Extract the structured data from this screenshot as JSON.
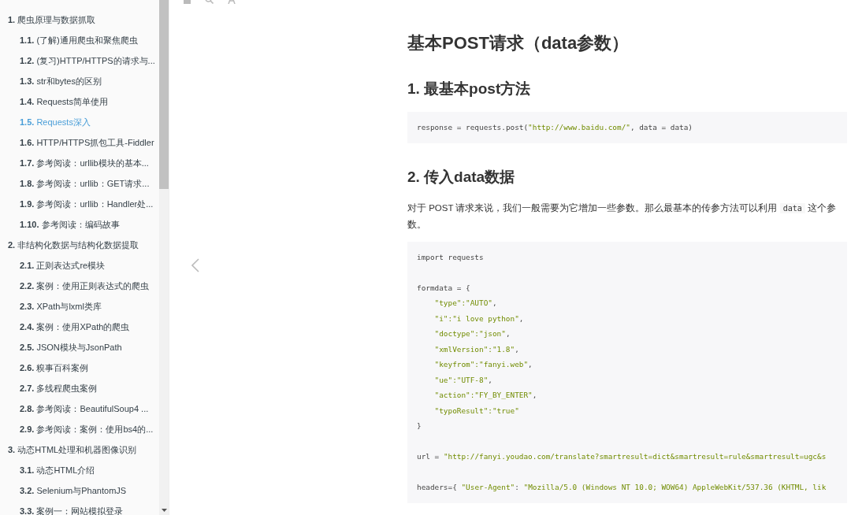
{
  "sidebar": {
    "items": [
      {
        "number": "1.",
        "title": "爬虫原理与数据抓取",
        "selected": false,
        "children": [
          {
            "number": "1.1.",
            "title": "(了解)通用爬虫和聚焦爬虫",
            "selected": false
          },
          {
            "number": "1.2.",
            "title": "(复习)HTTP/HTTPS的请求与...",
            "selected": false
          },
          {
            "number": "1.3.",
            "title": "str和bytes的区别",
            "selected": false
          },
          {
            "number": "1.4.",
            "title": "Requests简单使用",
            "selected": false
          },
          {
            "number": "1.5.",
            "title": "Requests深入",
            "selected": true
          },
          {
            "number": "1.6.",
            "title": "HTTP/HTTPS抓包工具-Fiddler",
            "selected": false
          },
          {
            "number": "1.7.",
            "title": "参考阅读：urllib模块的基本...",
            "selected": false
          },
          {
            "number": "1.8.",
            "title": "参考阅读：urllib：GET请求...",
            "selected": false
          },
          {
            "number": "1.9.",
            "title": "参考阅读：urllib：Handler处...",
            "selected": false
          },
          {
            "number": "1.10.",
            "title": "参考阅读：编码故事",
            "selected": false
          }
        ]
      },
      {
        "number": "2.",
        "title": "非结构化数据与结构化数据提取",
        "selected": false,
        "children": [
          {
            "number": "2.1.",
            "title": "正则表达式re模块",
            "selected": false
          },
          {
            "number": "2.2.",
            "title": "案例：使用正则表达式的爬虫",
            "selected": false
          },
          {
            "number": "2.3.",
            "title": "XPath与lxml类库",
            "selected": false
          },
          {
            "number": "2.4.",
            "title": "案例：使用XPath的爬虫",
            "selected": false
          },
          {
            "number": "2.5.",
            "title": "JSON模块与JsonPath",
            "selected": false
          },
          {
            "number": "2.6.",
            "title": "糗事百科案例",
            "selected": false
          },
          {
            "number": "2.7.",
            "title": "多线程爬虫案例",
            "selected": false
          },
          {
            "number": "2.8.",
            "title": "参考阅读：BeautifulSoup4 ...",
            "selected": false
          },
          {
            "number": "2.9.",
            "title": "参考阅读：案例：使用bs4的...",
            "selected": false
          }
        ]
      },
      {
        "number": "3.",
        "title": "动态HTML处理和机器图像识别",
        "selected": false,
        "children": [
          {
            "number": "3.1.",
            "title": "动态HTML介绍",
            "selected": false
          },
          {
            "number": "3.2.",
            "title": "Selenium与PhantomJS",
            "selected": false
          },
          {
            "number": "3.3.",
            "title": "案例一：网站模拟登录",
            "selected": false
          }
        ]
      }
    ]
  },
  "article": {
    "title": "基本POST请求（data参数）",
    "blocks": [
      {
        "kind": "heading",
        "text": "1. 最基本post方法"
      },
      {
        "kind": "code",
        "lines": [
          {
            "kind": "code",
            "tokens": [
              {
                "kind": "plain",
                "text": "response = requests.post("
              },
              {
                "kind": "string",
                "text": "\"http://www.baidu.com/\""
              },
              {
                "kind": "plain",
                "text": ", data = data)"
              }
            ]
          }
        ]
      },
      {
        "kind": "heading",
        "text": "2. 传入data数据"
      },
      {
        "kind": "paragraph",
        "parts": [
          {
            "kind": "text",
            "text": "对于 POST 请求来说，我们一般需要为它增加一些参数。那么最基本的传参方法可以利用 "
          },
          {
            "kind": "code",
            "text": "data"
          },
          {
            "kind": "text",
            "text": " 这个参数。"
          }
        ]
      },
      {
        "kind": "code",
        "lines": [
          {
            "kind": "code",
            "tokens": [
              {
                "kind": "plain",
                "text": "import requests"
              }
            ]
          },
          {
            "kind": "blank"
          },
          {
            "kind": "code",
            "tokens": [
              {
                "kind": "plain",
                "text": "formdata = {"
              }
            ]
          },
          {
            "kind": "code",
            "indented": true,
            "tokens": [
              {
                "kind": "string",
                "text": "\"type\":\"AUTO\""
              },
              {
                "kind": "plain",
                "text": ","
              }
            ]
          },
          {
            "kind": "code",
            "indented": true,
            "tokens": [
              {
                "kind": "string",
                "text": "\"i\":\"i love python\""
              },
              {
                "kind": "plain",
                "text": ","
              }
            ]
          },
          {
            "kind": "code",
            "indented": true,
            "tokens": [
              {
                "kind": "string",
                "text": "\"doctype\":\"json\""
              },
              {
                "kind": "plain",
                "text": ","
              }
            ]
          },
          {
            "kind": "code",
            "indented": true,
            "tokens": [
              {
                "kind": "string",
                "text": "\"xmlVersion\":\"1.8\""
              },
              {
                "kind": "plain",
                "text": ","
              }
            ]
          },
          {
            "kind": "code",
            "indented": true,
            "tokens": [
              {
                "kind": "string",
                "text": "\"keyfrom\":\"fanyi.web\""
              },
              {
                "kind": "plain",
                "text": ","
              }
            ]
          },
          {
            "kind": "code",
            "indented": true,
            "tokens": [
              {
                "kind": "string",
                "text": "\"ue\":\"UTF-8\""
              },
              {
                "kind": "plain",
                "text": ","
              }
            ]
          },
          {
            "kind": "code",
            "indented": true,
            "tokens": [
              {
                "kind": "string",
                "text": "\"action\":\"FY_BY_ENTER\""
              },
              {
                "kind": "plain",
                "text": ","
              }
            ]
          },
          {
            "kind": "code",
            "indented": true,
            "tokens": [
              {
                "kind": "string",
                "text": "\"typoResult\":\"true\""
              }
            ]
          },
          {
            "kind": "code",
            "tokens": [
              {
                "kind": "plain",
                "text": "}"
              }
            ]
          },
          {
            "kind": "blank"
          },
          {
            "kind": "code",
            "tokens": [
              {
                "kind": "plain",
                "text": "url = "
              },
              {
                "kind": "string",
                "text": "\"http://fanyi.youdao.com/translate?smartresult=dict&smartresult=rule&smartresult=ugc&s"
              }
            ]
          },
          {
            "kind": "blank"
          },
          {
            "kind": "code",
            "tokens": [
              {
                "kind": "plain",
                "text": "headers={ "
              },
              {
                "kind": "string",
                "text": "\"User-Agent\""
              },
              {
                "kind": "plain",
                "text": ": "
              },
              {
                "kind": "string",
                "text": "\"Mozilla/5.0 (Windows NT 10.0; WOW64) AppleWebKit/537.36 (KHTML, lik"
              }
            ]
          }
        ]
      }
    ]
  }
}
